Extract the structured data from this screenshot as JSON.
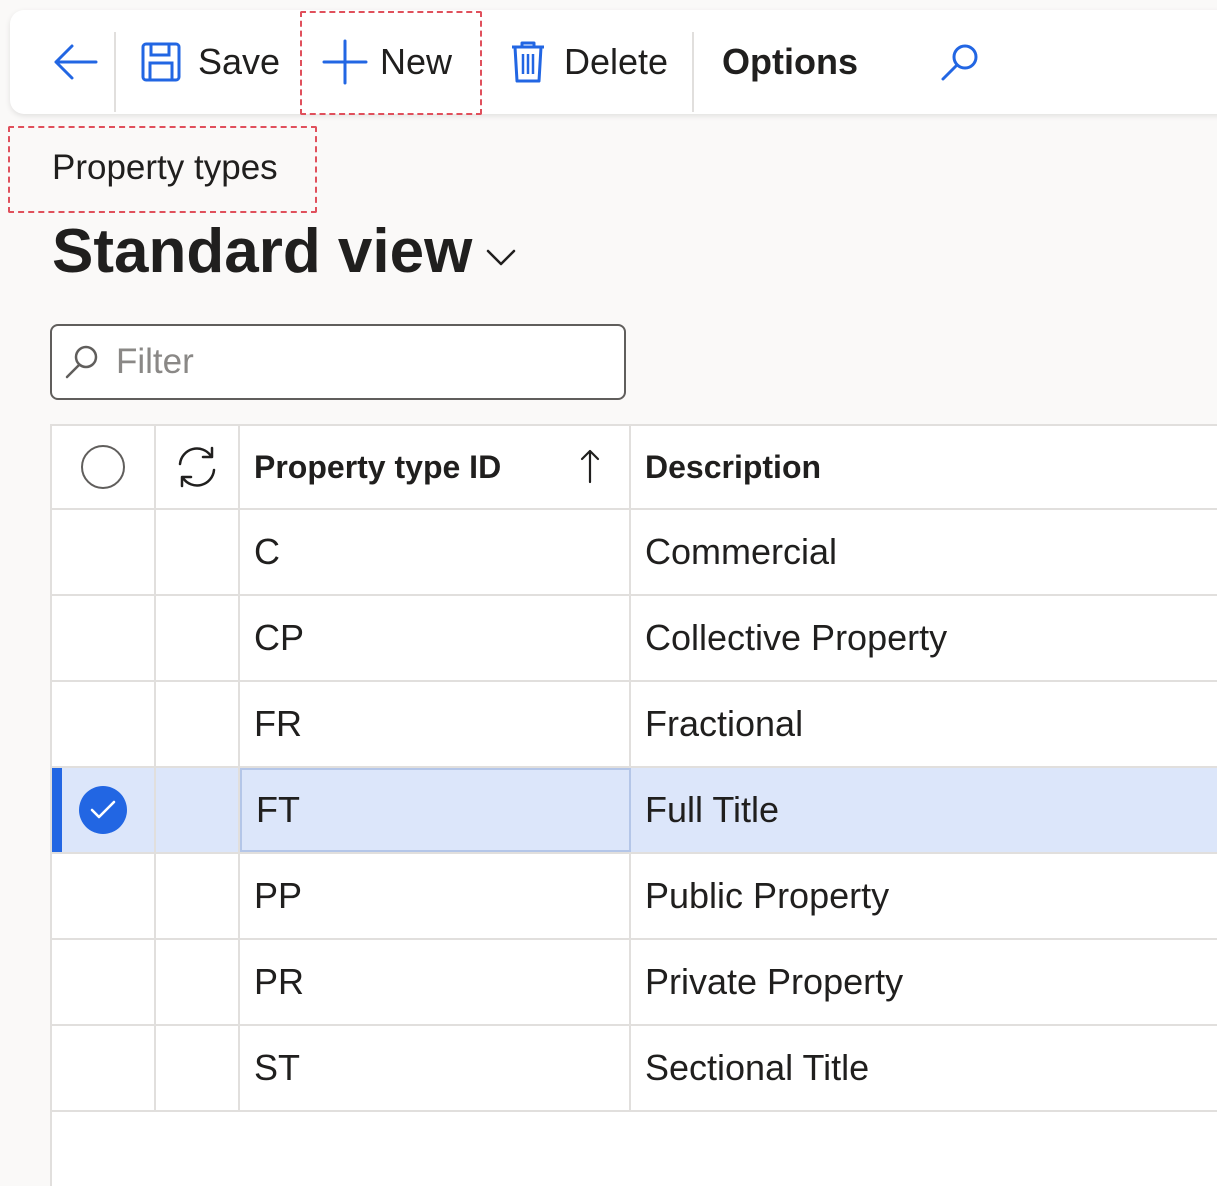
{
  "toolbar": {
    "back_label": "Back",
    "save_label": "Save",
    "new_label": "New",
    "delete_label": "Delete",
    "options_label": "Options"
  },
  "page": {
    "caption": "Property types",
    "view_title": "Standard view"
  },
  "filter": {
    "placeholder": "Filter",
    "value": ""
  },
  "grid": {
    "columns": {
      "id": "Property type ID",
      "description": "Description"
    },
    "sort": {
      "column": "Property type ID",
      "direction": "ascending"
    },
    "rows": [
      {
        "id": "C",
        "description": "Commercial",
        "selected": false
      },
      {
        "id": "CP",
        "description": "Collective Property",
        "selected": false
      },
      {
        "id": "FR",
        "description": "Fractional",
        "selected": false
      },
      {
        "id": "FT",
        "description": "Full Title",
        "selected": true
      },
      {
        "id": "PP",
        "description": "Public Property",
        "selected": false
      },
      {
        "id": "PR",
        "description": "Private Property",
        "selected": false
      },
      {
        "id": "ST",
        "description": "Sectional Title",
        "selected": false
      }
    ]
  },
  "colors": {
    "accent": "#2266e3",
    "selected_row": "#dce6fa",
    "highlight_box": "#e0505c"
  },
  "icons": {
    "back": "arrow-left-icon",
    "save": "floppy-disk-icon",
    "new": "plus-icon",
    "delete": "trash-icon",
    "search": "search-icon",
    "refresh": "refresh-icon",
    "sort": "sort-up-icon"
  }
}
